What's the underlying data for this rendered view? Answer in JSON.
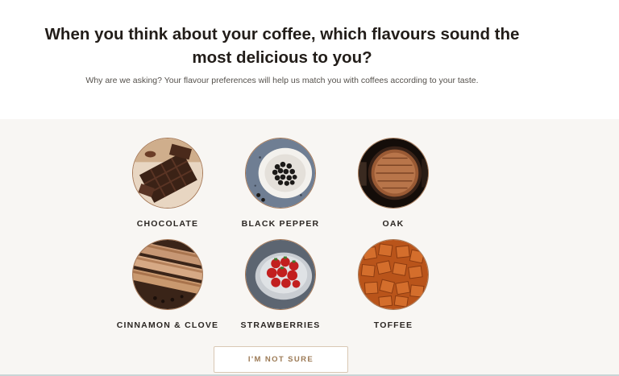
{
  "question": {
    "title": "When you think about your coffee, which flavours sound the most delicious to you?",
    "subtitle": "Why are we asking? Your flavour preferences will help us match you with coffees according to your taste."
  },
  "flavours": [
    {
      "label": "CHOCOLATE",
      "image": "chocolate-pieces"
    },
    {
      "label": "BLACK PEPPER",
      "image": "black-peppercorns-bowl"
    },
    {
      "label": "OAK",
      "image": "oak-barrel"
    },
    {
      "label": "CINNAMON & CLOVE",
      "image": "cinnamon-sticks"
    },
    {
      "label": "STRAWBERRIES",
      "image": "strawberries-bowl"
    },
    {
      "label": "TOFFEE",
      "image": "toffee-cubes"
    }
  ],
  "actions": {
    "not_sure_label": "I'M NOT SURE"
  },
  "colors": {
    "panel_bg": "#f8f6f3",
    "circle_border": "#a77957",
    "button_text": "#9c7a55",
    "button_border": "#d9c8b4"
  }
}
